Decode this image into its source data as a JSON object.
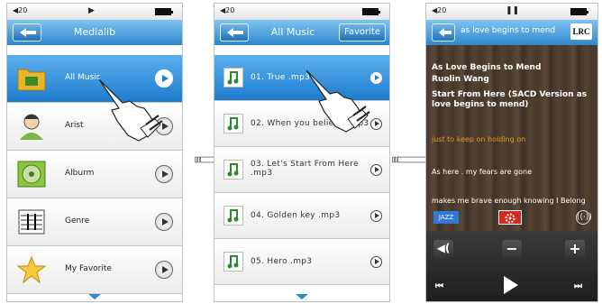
{
  "screen1": {
    "status": {
      "volume": "20"
    },
    "title": "Medialib",
    "items": [
      {
        "label": "All Music",
        "icon": "folder-music-icon"
      },
      {
        "label": "Arist",
        "icon": "artist-icon"
      },
      {
        "label": "Alburm",
        "icon": "album-disc-icon"
      },
      {
        "label": "Genre",
        "icon": "genre-sheet-music-icon"
      },
      {
        "label": "My Favorite",
        "icon": "star-icon"
      }
    ]
  },
  "screen2": {
    "status": {
      "volume": "20"
    },
    "title": "All Music",
    "favorite_label": "Favorite",
    "songs": [
      {
        "label": "01. True .mp3"
      },
      {
        "label": "02. When you believe .mp3"
      },
      {
        "label": "03. Let's Start From Here .mp3"
      },
      {
        "label": "04. Golden key .mp3"
      },
      {
        "label": "05. Hero .mp3"
      }
    ]
  },
  "screen3": {
    "status": {
      "volume": "20"
    },
    "title": "as love begins to mend",
    "lrc_label": "LRC",
    "track_title": "As Love Begins to Mend",
    "artist": "Ruolin Wang",
    "album": "Start From Here (SACD Version as love begins to mend)",
    "lyric_current": "just to keep on holding on",
    "lyric_2": "As here . my fears are gone",
    "lyric_3": "makes me brave enough knowing I Belong",
    "eq_label": "JAZZ"
  },
  "colors": {
    "accent": "#2f87cc",
    "current_lyric": "#e89a1e",
    "settings_red": "#d42a20"
  }
}
